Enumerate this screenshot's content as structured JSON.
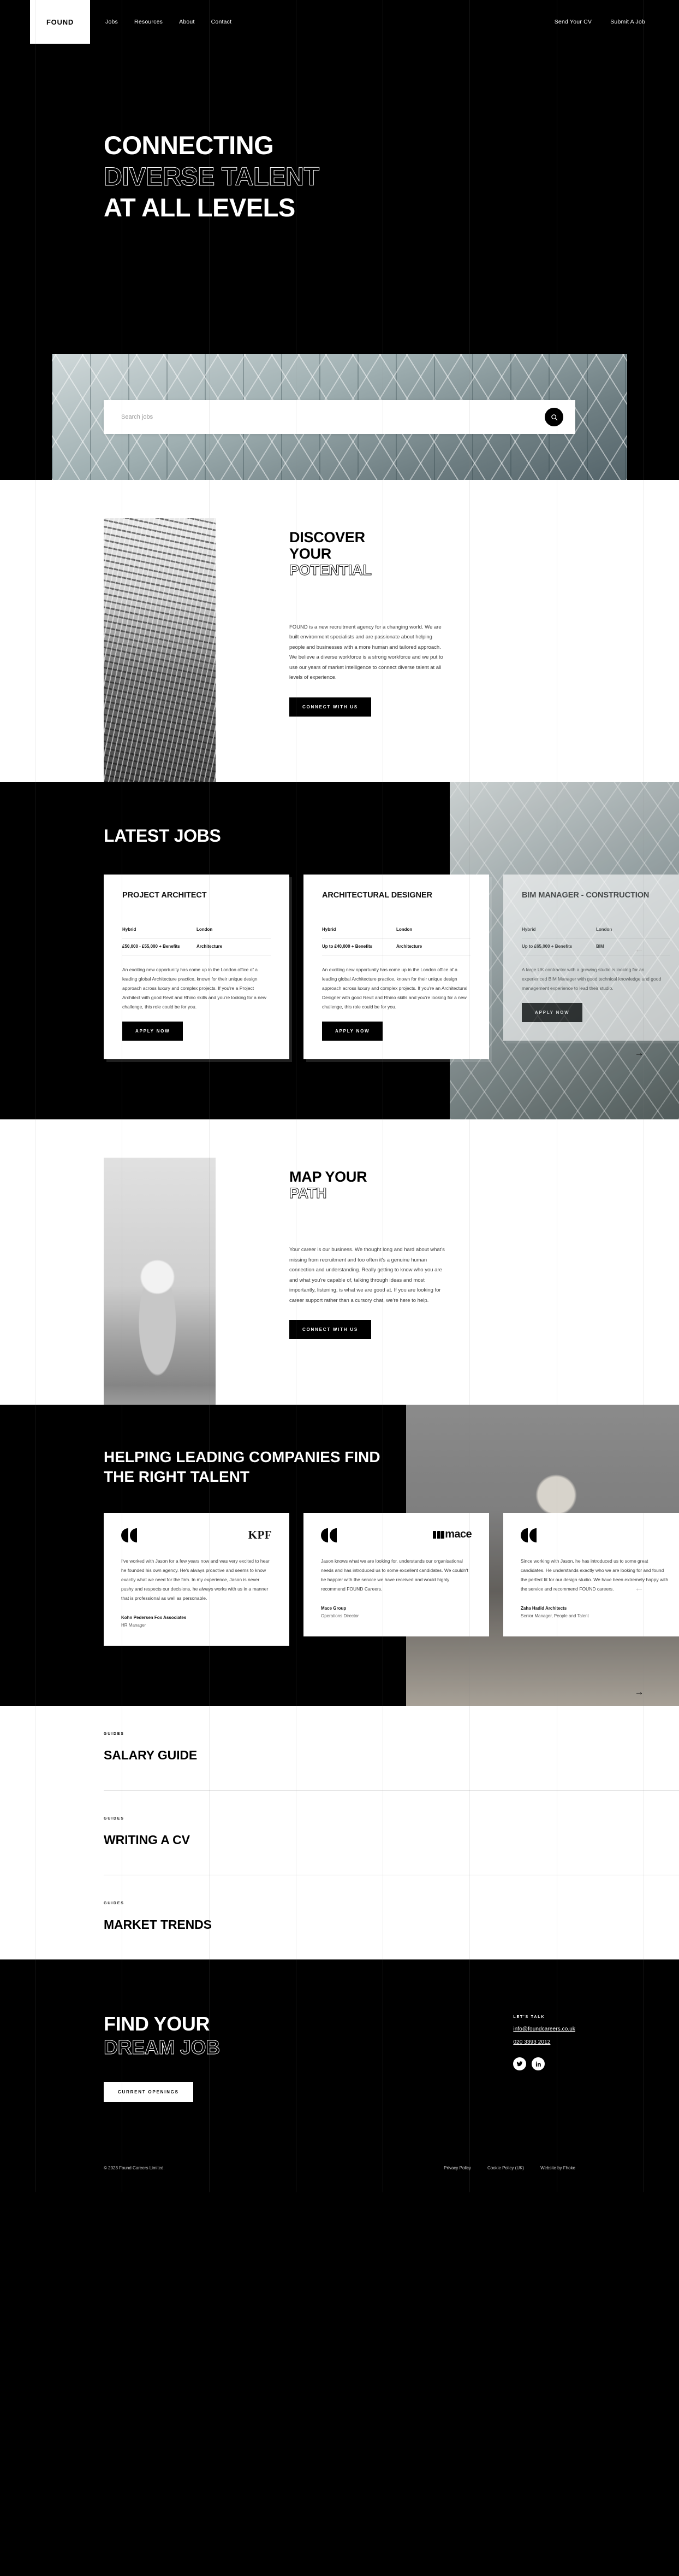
{
  "brand": {
    "logo": "FOUND"
  },
  "nav": {
    "links": [
      {
        "label": "Jobs"
      },
      {
        "label": "Resources"
      },
      {
        "label": "About"
      },
      {
        "label": "Contact"
      }
    ],
    "actions": [
      {
        "label": "Send Your CV"
      },
      {
        "label": "Submit A Job"
      }
    ]
  },
  "hero": {
    "line1": "CONNECTING",
    "line2": "DIVERSE TALENT",
    "line3": "AT ALL LEVELS"
  },
  "search": {
    "placeholder": "Search jobs",
    "value": "",
    "icon": "search-icon"
  },
  "discover": {
    "title_line1": "DISCOVER",
    "title_line2": "YOUR",
    "title_line3": "POTENTIAL",
    "paragraph": "FOUND is a new recruitment agency for a changing world. We are built environment specialists and are passionate about helping people and businesses with a more human and tailored approach. We believe a diverse workforce is a strong workforce and we put to use our years of market intelligence to connect diverse talent at all levels of experience.",
    "cta": "CONNECT WITH US"
  },
  "jobs": {
    "heading": "LATEST JOBS",
    "prev_icon": "arrow-left-icon",
    "next_icon": "arrow-right-icon",
    "apply_label": "APPLY NOW",
    "items": [
      {
        "title": "PROJECT ARCHITECT",
        "work_type": "Hybrid",
        "location": "London",
        "salary": "£50,000 - £55,000 + Benefits",
        "sector": "Architecture",
        "description": "An exciting new opportunity has come up in the London office of a leading global Architecture practice, known for their unique design approach across luxury and complex projects. If you're a Project Architect with good Revit and Rhino skills and you're looking for a new challenge, this role could be for you."
      },
      {
        "title": "ARCHITECTURAL DESIGNER",
        "work_type": "Hybrid",
        "location": "London",
        "salary": "Up to £40,000 + Benefits",
        "sector": "Architecture",
        "description": "An exciting new opportunity has come up in the London office of a leading global Architecture practice, known for their unique design approach across luxury and complex projects. If you're an Architectural Designer with good Revit and Rhino skills and you're looking for a new challenge, this role could be for you."
      },
      {
        "title": "BIM MANAGER - CONSTRUCTION",
        "work_type": "Hybrid",
        "location": "London",
        "salary": "Up to £65,000 + Benefits",
        "sector": "BIM",
        "description": "A large UK contractor with a growing studio is looking for an experienced BIM Manager with good technical knowledge and good management experience to lead their studio."
      }
    ]
  },
  "path": {
    "title_line1": "MAP YOUR",
    "title_line2": "PATH",
    "paragraph": "Your career is our business. We thought long and hard about what's missing from recruitment and too often it's a genuine human connection and understanding. Really getting to know who you are and what you're capable of, talking through ideas and most importantly, listening, is what we are good at. If you are looking for career support rather than a cursory chat, we're here to help.",
    "cta": "CONNECT WITH US"
  },
  "companies": {
    "heading": "HELPING LEADING COMPANIES FIND THE RIGHT TALENT",
    "prev_icon": "arrow-left-icon",
    "next_icon": "arrow-right-icon",
    "testimonials": [
      {
        "logo": "KPF",
        "logo_type": "kpf",
        "quote": "I've worked with Jason for a few years now and was very excited to hear he founded his own agency. He's always proactive and seems to know exactly what we need for the firm. In my experience, Jason is never pushy and respects our decisions, he always works with us in a manner that is professional as well as personable.",
        "company": "Kohn Pedersen Fox Associates",
        "role": "HR Manager"
      },
      {
        "logo": "mace",
        "logo_type": "mace",
        "quote": "Jason knows what we are looking for, understands our organisational needs and has introduced us to some excellent candidates. We couldn't be happier with the service we have received and would highly recommend FOUND Careers.",
        "company": "Mace Group",
        "role": "Operations Director"
      },
      {
        "logo": "",
        "logo_type": "none",
        "quote": "Since working with Jason, he has introduced us to some great candidates. He understands exactly who we are looking for and found the perfect fit for our design studio. We have been extremely happy with the service and recommend FOUND careers.",
        "company": "Zaha Hadid Architects",
        "role": "Senior Manager, People and Talent"
      }
    ]
  },
  "guides": {
    "kicker": "GUIDES",
    "items": [
      {
        "title": "SALARY GUIDE"
      },
      {
        "title": "WRITING A CV"
      },
      {
        "title": "MARKET TRENDS"
      }
    ]
  },
  "footer": {
    "title_line1": "FIND YOUR",
    "title_line2": "DREAM JOB",
    "cta": "CURRENT OPENINGS",
    "lets_talk": "LET'S TALK",
    "email": "info@foundcareers.co.uk",
    "phone": "020 3393 2012",
    "socials": [
      {
        "name": "twitter-icon",
        "glyph": "ᴛ"
      },
      {
        "name": "linkedin-icon",
        "glyph": "in"
      }
    ],
    "copyright": "© 2023 Found Careers Limited.",
    "links": [
      {
        "label": "Privacy Policy"
      },
      {
        "label": "Cookie Policy (UK)"
      },
      {
        "label": "Website by Fhoke"
      }
    ]
  }
}
